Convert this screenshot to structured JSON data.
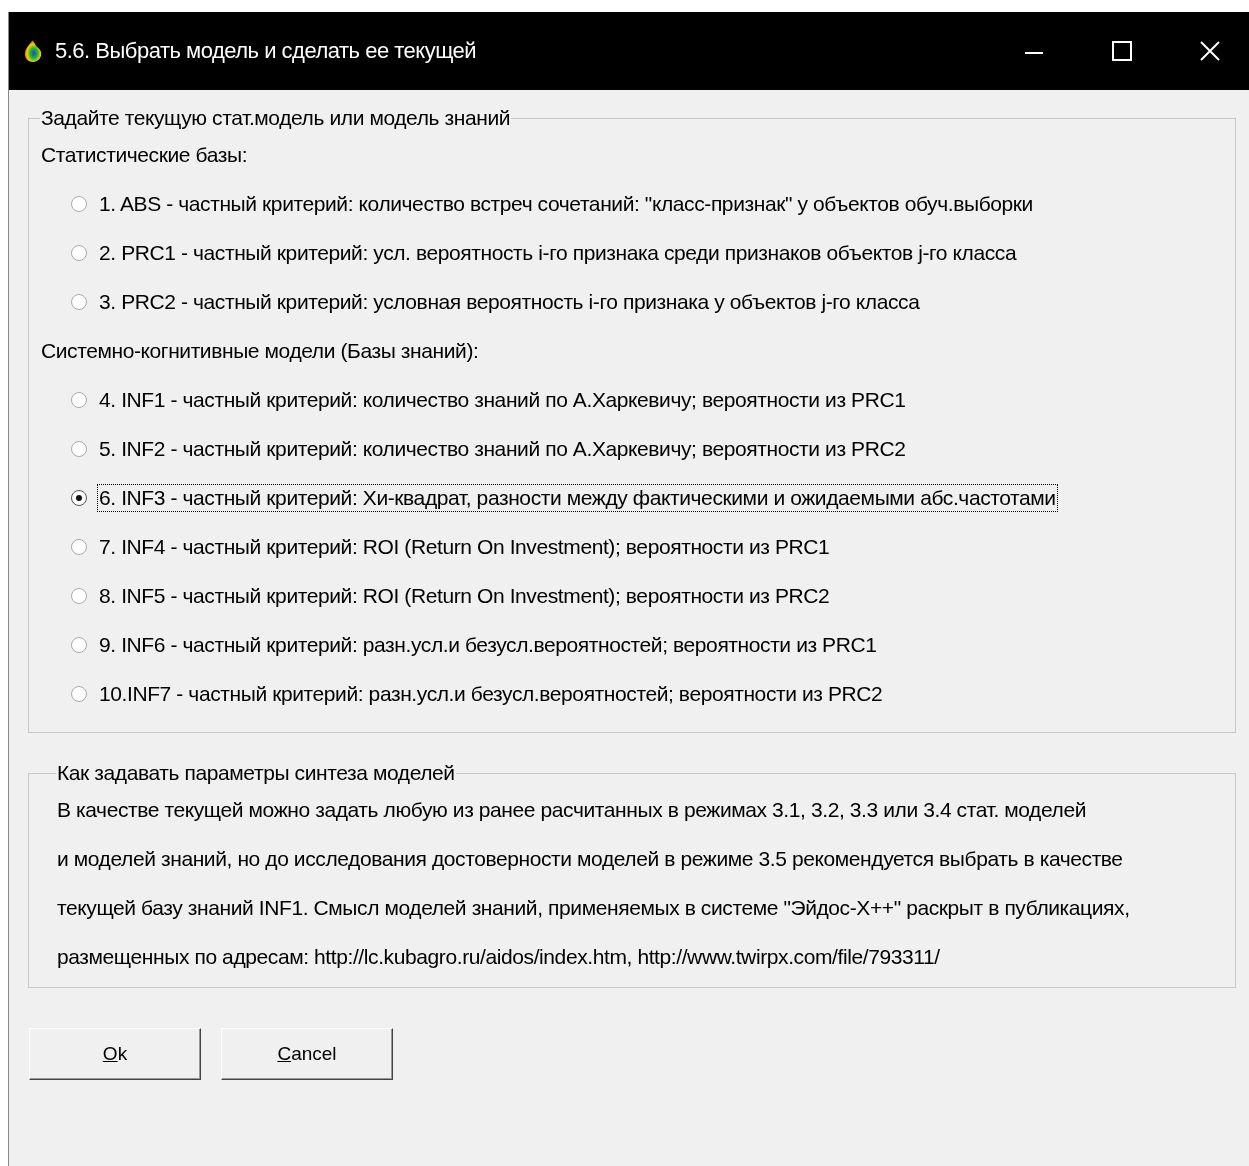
{
  "window": {
    "title": "5.6. Выбрать модель и сделать ее текущей"
  },
  "model_group": {
    "legend": "Задайте текущую стат.модель или модель знаний",
    "sections": [
      {
        "heading": "Статистические базы:",
        "options": [
          {
            "label": "1. ABS  - частный критерий: количество встреч сочетаний: \"класс-признак\" у объектов обуч.выборки",
            "selected": false
          },
          {
            "label": "2. PRC1 - частный критерий: усл. вероятность i-го признака среди признаков объектов j-го класса",
            "selected": false
          },
          {
            "label": "3. PRC2 - частный критерий: условная вероятность i-го признака у объектов j-го класса",
            "selected": false
          }
        ]
      },
      {
        "heading": "Системно-когнитивные модели (Базы знаний):",
        "options": [
          {
            "label": "4. INF1 - частный критерий: количество знаний по А.Харкевичу; вероятности из PRC1",
            "selected": false
          },
          {
            "label": "5. INF2 - частный критерий: количество знаний по А.Харкевичу; вероятности из PRC2",
            "selected": false
          },
          {
            "label": "6. INF3 - частный критерий: Хи-квадрат, разности между фактическими и ожидаемыми абс.частотами",
            "selected": true
          },
          {
            "label": "7. INF4 - частный критерий: ROI (Return On Investment); вероятности из PRC1",
            "selected": false
          },
          {
            "label": "8. INF5 - частный критерий: ROI (Return On Investment); вероятности из PRC2",
            "selected": false
          },
          {
            "label": "9. INF6 - частный критерий: разн.усл.и безусл.вероятностей; вероятности из PRC1",
            "selected": false
          },
          {
            "label": "10.INF7 - частный критерий: разн.усл.и безусл.вероятностей; вероятности из PRC2",
            "selected": false
          }
        ]
      }
    ]
  },
  "help_group": {
    "legend": "Как задавать параметры синтеза моделей",
    "lines": [
      "В качестве текущей можно задать любую из ранее расчитанных в режимах 3.1, 3.2, 3.3 или 3.4 стат. моделей",
      "и моделей знаний, но до исследования достоверности моделей в режиме 3.5 рекомендуется выбрать в качестве",
      "текущей базу знаний INF1. Смысл моделей знаний, применяемых в системе \"Эйдос-X++\" раскрыт в публикациях,",
      "размещенных по адресам: http://lc.kubagro.ru/aidos/index.htm, http://www.twirpx.com/file/793311/"
    ]
  },
  "buttons": [
    "Ok",
    "Cancel"
  ]
}
